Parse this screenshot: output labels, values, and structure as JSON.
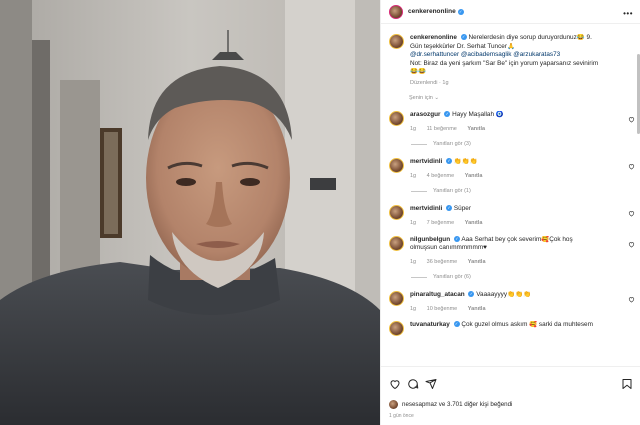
{
  "post": {
    "username": "cenkerenonline",
    "caption_user": "cenkerenonline",
    "caption_line1": "Nerelerdesin diye sorup duruyordunuz😂 9.",
    "caption_line2": "Gün teşekkürler Dr. Serhat Tuncer🙏",
    "caption_tags": "@dr.serhattuncer @acibademsaglik @arzukaratas73",
    "caption_note1": "Not: Biraz da yeni şarkım \"Sar Be\" için yorum yaparsanız sevinirim",
    "caption_note2": "😂😂",
    "edited_label": "Düzenlendi · 1g",
    "translation_label": "Şenin için ⌄"
  },
  "comments": [
    {
      "user": "arasozgur",
      "text": "Hayy Maşallah 🧿",
      "time": "1g",
      "likes": "11 beğenme",
      "reply": "Yanıtla",
      "replies": "Yanıtları gör (3)"
    },
    {
      "user": "mertvidinli",
      "text": "👏👏👏",
      "time": "1g",
      "likes": "4 beğenme",
      "reply": "Yanıtla",
      "replies": "Yanıtları gör (1)"
    },
    {
      "user": "mertvidinli",
      "text": "Süper",
      "time": "1g",
      "likes": "7 beğenme",
      "reply": "Yanıtla",
      "replies": ""
    },
    {
      "user": "nilgunbelgun",
      "text": "Aaa Serhat bey çok severim🥰Çok hoş",
      "text2": "olmuşsun canımmmmmm♥",
      "time": "1g",
      "likes": "36 beğenme",
      "reply": "Yanıtla",
      "replies": "Yanıtları gör (6)"
    },
    {
      "user": "pinaraltug_atacan",
      "text": "Vaaaayyyy👏👏👏",
      "time": "1g",
      "likes": "10 beğenme",
      "reply": "Yanıtla",
      "replies": ""
    },
    {
      "user": "tuvanaturkay",
      "text": "Çok guzel olmus askım 🥰 sarki da muhtesem",
      "time": "",
      "likes": "",
      "reply": "",
      "replies": ""
    }
  ],
  "footer": {
    "likes_text": "nesesapmaz ve 3.701 diğer kişi beğendi",
    "ago": "1 gün önce"
  },
  "icons": {
    "heart": "heart-icon",
    "comment": "comment-icon",
    "share": "share-icon",
    "save": "bookmark-icon",
    "more": "more-icon"
  },
  "colors": {
    "link": "#00376b",
    "verified": "#3897f0",
    "muted": "#8e8e8e"
  }
}
